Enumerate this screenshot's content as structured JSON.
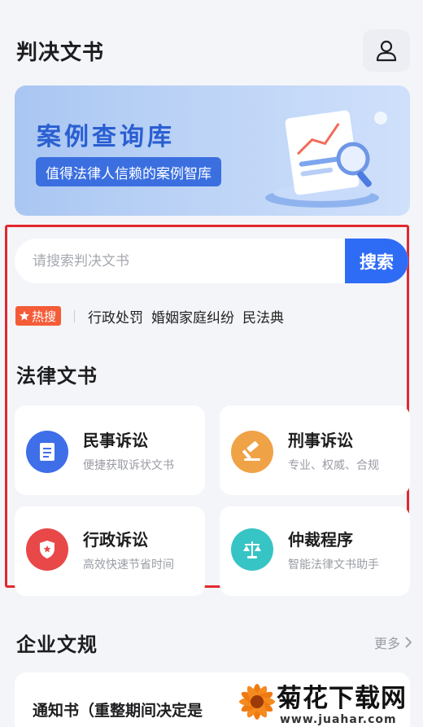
{
  "header": {
    "title": "判决文书",
    "user_icon": "user-icon"
  },
  "banner": {
    "title": "案例查询库",
    "subtitle": "值得法律人信赖的案例智库"
  },
  "search": {
    "placeholder": "请搜索判决文书",
    "button_label": "搜索"
  },
  "hot": {
    "badge_label": "热搜",
    "tags": [
      "行政处罚",
      "婚姻家庭纠纷",
      "民法典"
    ]
  },
  "legal_docs": {
    "title": "法律文书",
    "cards": [
      {
        "title": "民事诉讼",
        "desc": "便捷获取诉状文书",
        "icon": "document-icon",
        "color": "#3e6ee8"
      },
      {
        "title": "刑事诉讼",
        "desc": "专业、权威、合规",
        "icon": "gavel-icon",
        "color": "#f0a247"
      },
      {
        "title": "行政诉讼",
        "desc": "高效快速节省时间",
        "icon": "shield-icon",
        "color": "#e84848"
      },
      {
        "title": "仲裁程序",
        "desc": "智能法律文书助手",
        "icon": "scales-icon",
        "color": "#36c4c4"
      }
    ]
  },
  "enterprise": {
    "title": "企业文规",
    "more_label": "更多"
  },
  "notice": {
    "text": "通知书（重整期间决定是"
  },
  "watermark": {
    "name": "菊花下载网",
    "url": "www.juahar.com"
  }
}
